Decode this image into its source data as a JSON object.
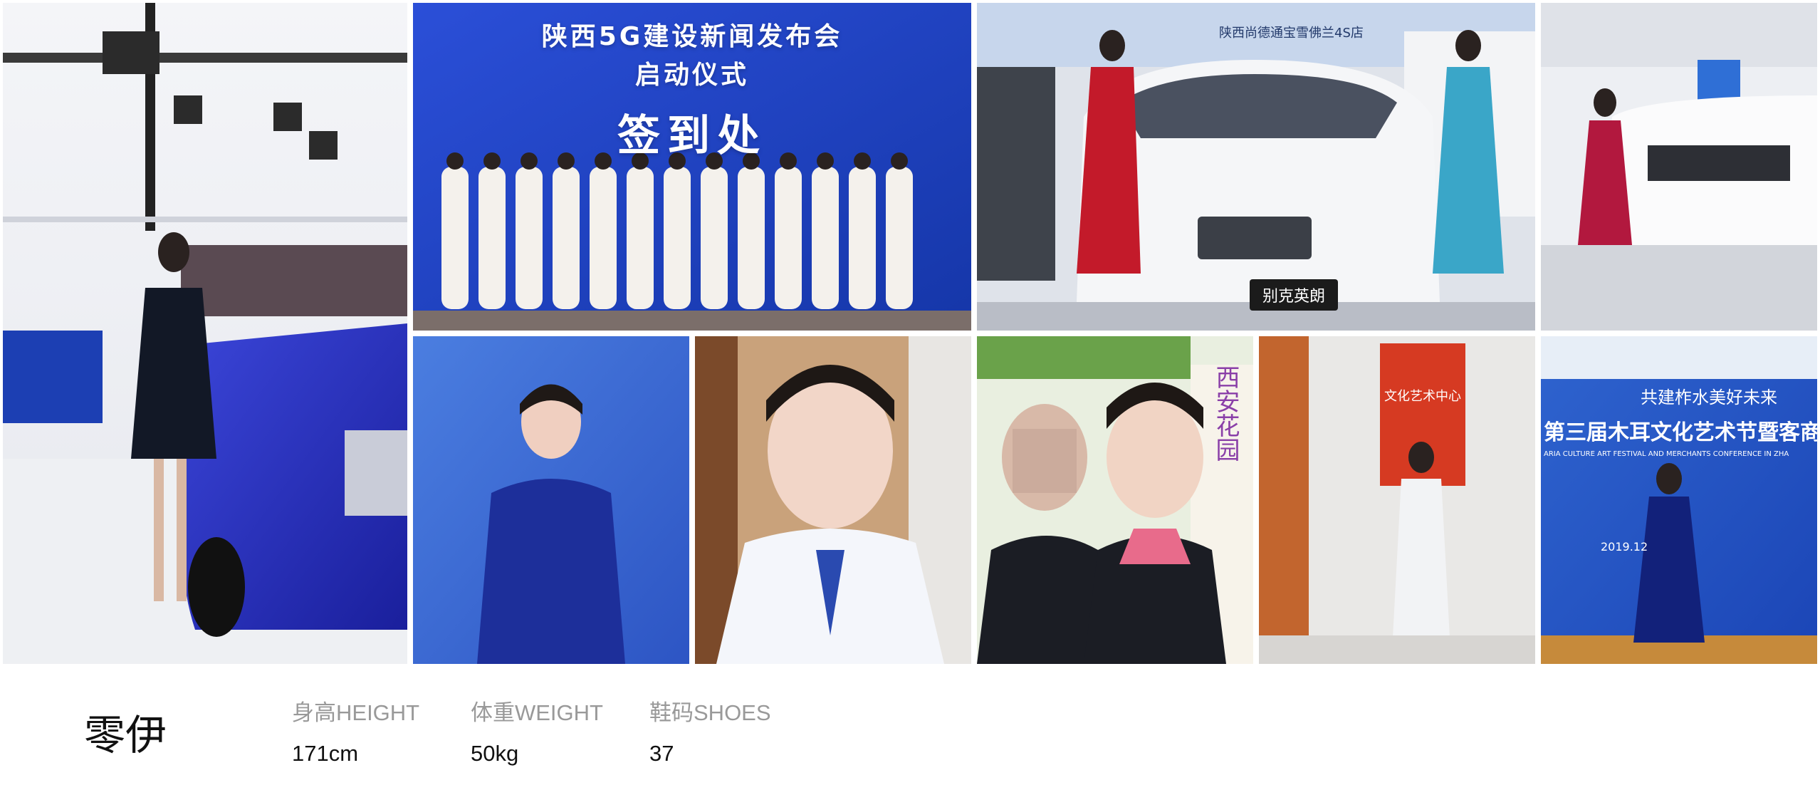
{
  "model": {
    "name": "零伊"
  },
  "stats": [
    {
      "label": "身高HEIGHT",
      "value": "171cm"
    },
    {
      "label": "体重WEIGHT",
      "value": "50kg"
    },
    {
      "label": "鞋码SHOES",
      "value": "37"
    }
  ],
  "photos": {
    "press_banner_line1": "陕西5G建设新闻发布会",
    "press_banner_line2": "启动仪式",
    "press_banner_signin": "签到处",
    "car_plate": "别克英朗",
    "dealer_sign": "陕西尚德通宝雪佛兰4S店",
    "culture_sign": "文化艺术中心",
    "festival_slogan": "共建柞水美好未来",
    "festival_title": "第三届木耳文化艺术节暨客商",
    "festival_sub": "ARIA CULTURE ART FESTIVAL AND MERCHANTS CONFERENCE IN ZHA",
    "festival_date": "2019.12"
  }
}
